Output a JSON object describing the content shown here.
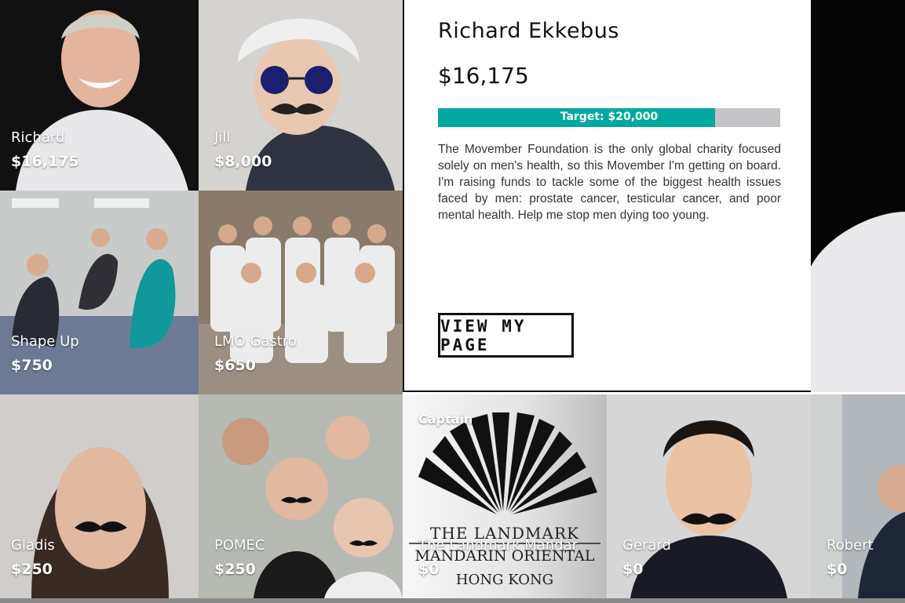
{
  "detail": {
    "name": "Richard Ekkebus",
    "amount": "$16,175",
    "target_label": "Target: $20,000",
    "progress": 0.809,
    "description": "The Movember Foundation is the only global charity focused solely on men's health, so this Movember I'm getting on board. I'm raising funds to tackle some of the biggest health issues faced by men: prostate cancer, testicular cancer, and poor mental health. Help me stop men dying too young.",
    "button_label": "VIEW MY PAGE"
  },
  "tiles": [
    {
      "name": "Richard",
      "amount": "$16,175"
    },
    {
      "name": "Jill",
      "amount": "$8,000"
    },
    {
      "name": "Shape Up",
      "amount": "$750"
    },
    {
      "name": "LMO Gastro",
      "amount": "$650"
    },
    {
      "name": "Gladis",
      "amount": "$250"
    },
    {
      "name": "POMEC",
      "amount": "$250"
    },
    {
      "name": "The Landmark Mandar",
      "amount": "$0",
      "badge": "Captain",
      "logo": {
        "line1": "THE LANDMARK",
        "line2": "MANDARIN ORIENTAL",
        "line3": "HONG KONG"
      }
    },
    {
      "name": "Gerard",
      "amount": "$0"
    },
    {
      "name": "Robert",
      "amount": "$0"
    }
  ],
  "colors": {
    "accent": "#00a99d",
    "bar_bg": "#c4c4c6"
  }
}
